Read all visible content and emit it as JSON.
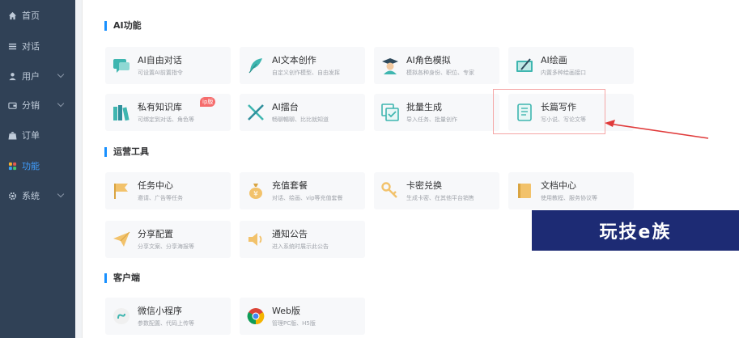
{
  "sidebar": {
    "items": [
      {
        "label": "首页",
        "icon": "home-icon"
      },
      {
        "label": "对话",
        "icon": "list-icon"
      },
      {
        "label": "用户",
        "icon": "user-icon"
      },
      {
        "label": "分销",
        "icon": "wallet-icon"
      },
      {
        "label": "订单",
        "icon": "bag-icon"
      },
      {
        "label": "功能",
        "icon": "grid-icon"
      },
      {
        "label": "系统",
        "icon": "gear-icon"
      }
    ]
  },
  "sections": {
    "ai": {
      "title": "AI功能",
      "cards": [
        {
          "title": "AI自由对话",
          "desc": "可设置AI前置指令"
        },
        {
          "title": "AI文本创作",
          "desc": "自定义创作模型、自由发挥"
        },
        {
          "title": "AI角色模拟",
          "desc": "模拟各种身份、职位、专家"
        },
        {
          "title": "AI绘画",
          "desc": "内置多种绘画接口"
        },
        {
          "title": "私有知识库",
          "desc": "可绑定到对话、角色等",
          "badge": "ip版"
        },
        {
          "title": "AI擂台",
          "desc": "畅聊暢聊、比比就知道"
        },
        {
          "title": "批量生成",
          "desc": "导入任务、批量创作"
        },
        {
          "title": "长篇写作",
          "desc": "写小说、写论文等"
        }
      ]
    },
    "ops": {
      "title": "运营工具",
      "cards": [
        {
          "title": "任务中心",
          "desc": "邀请、广告等任务"
        },
        {
          "title": "充值套餐",
          "desc": "对话、绘画、vip等充值套餐"
        },
        {
          "title": "卡密兑换",
          "desc": "生成卡密、在其他平台销售"
        },
        {
          "title": "文档中心",
          "desc": "使用教程、服务协议等"
        },
        {
          "title": "分享配置",
          "desc": "分享文案、分享海报等"
        },
        {
          "title": "通知公告",
          "desc": "进入系统时展示此公告"
        }
      ]
    },
    "client": {
      "title": "客户端",
      "cards": [
        {
          "title": "微信小程序",
          "desc": "参数配置、代码上传等"
        },
        {
          "title": "Web版",
          "desc": "管理PC版、H5版"
        }
      ]
    }
  },
  "watermark": {
    "text": "玩技e族"
  },
  "colors": {
    "sidebar_bg": "#304156",
    "active": "#409eff",
    "accent": "#1890ff",
    "arrow": "#e03a3a"
  }
}
